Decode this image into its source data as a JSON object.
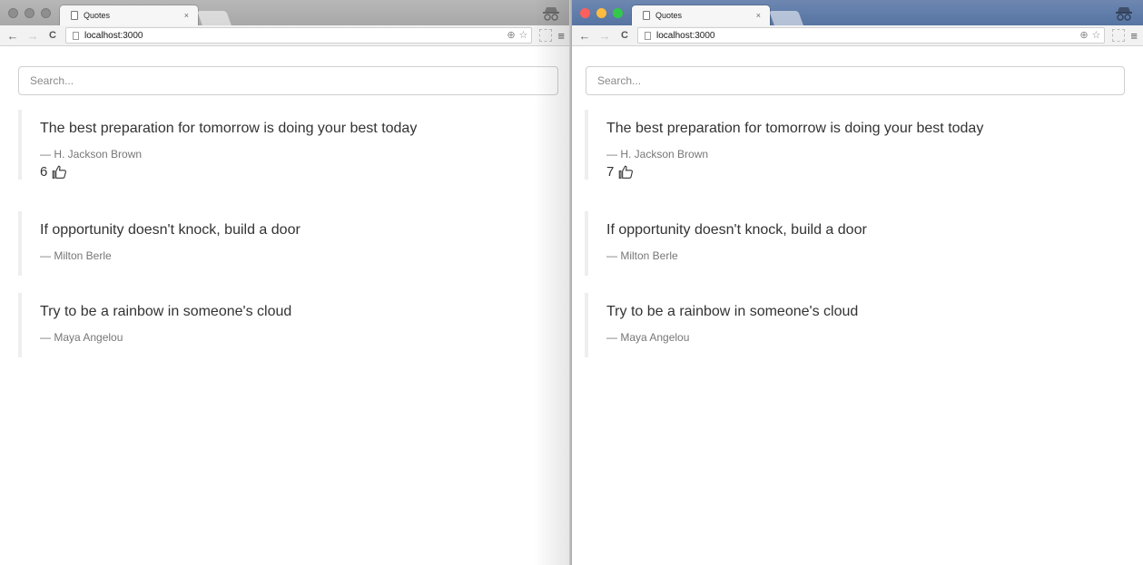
{
  "windows": [
    {
      "tab_title": "Quotes",
      "tab_close": "×",
      "url_host": "localhost",
      "url_port": ":3000",
      "search_placeholder": "Search...",
      "quotes": [
        {
          "text": "The best preparation for tomorrow is doing your best today",
          "author": "— H. Jackson Brown",
          "likes": "6"
        },
        {
          "text": "If opportunity doesn't knock, build a door",
          "author": "— Milton Berle"
        },
        {
          "text": "Try to be a rainbow in someone's cloud",
          "author": "— Maya Angelou"
        }
      ]
    },
    {
      "tab_title": "Quotes",
      "tab_close": "×",
      "url_host": "localhost",
      "url_port": ":3000",
      "search_placeholder": "Search...",
      "quotes": [
        {
          "text": "The best preparation for tomorrow is doing your best today",
          "author": "— H. Jackson Brown",
          "likes": "7"
        },
        {
          "text": "If opportunity doesn't knock, build a door",
          "author": "— Milton Berle"
        },
        {
          "text": "Try to be a rainbow in someone's cloud",
          "author": "— Maya Angelou"
        }
      ]
    }
  ],
  "icons": {
    "page": "page-icon",
    "back": "back-arrow-icon",
    "forward": "forward-arrow-icon",
    "reload": "reload-icon",
    "zoom": "zoom-icon",
    "star": "bookmark-star-icon",
    "menu": "hamburger-menu-icon",
    "incognito": "incognito-icon",
    "like": "thumbs-up-icon"
  },
  "colors": {
    "inactive_titlebar": "#a8a8a8",
    "active_titlebar": "#5674a3",
    "quote_border": "#eeeeee"
  }
}
